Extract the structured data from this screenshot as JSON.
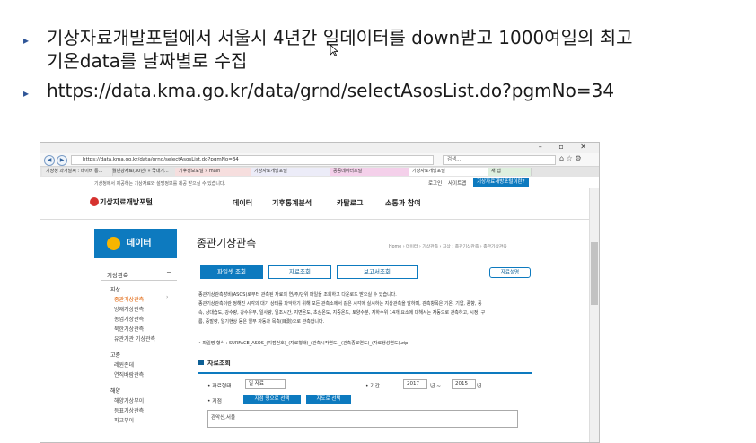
{
  "slide": {
    "bullets": [
      {
        "marker": "▸",
        "line1": "기상자료개발포털에서 서울시 4년간 일데이터를 down받고 1000여일의 최고",
        "line2": "기온data를 날짜별로 수집"
      },
      {
        "marker": "▸",
        "line1": "https://data.kma.go.kr/data/grnd/selectAsosList.do?pgmNo=34"
      }
    ]
  },
  "browser": {
    "url": "https://data.kma.go.kr/data/grnd/selectAsosList.do?pgmNo=34",
    "search_placeholder": "검색...",
    "tabs": [
      "기상청 과거날씨 : 네이버 통...",
      "월년강자료(30년) » 국내기...",
      "기후정보포털 » main",
      "기상자료개방포털",
      "공공데이터포털",
      "기상자료개방포털",
      "새 탭"
    ],
    "info_text": "기상청에서 제공하는 기상자료와 설명정보를 제공 받으실 수 있습니다.",
    "info_links": [
      "로그인",
      "사이트맵"
    ],
    "info_button": "기상자료개방포털이란?"
  },
  "site": {
    "logo": "기상자료개방포털",
    "gnb": [
      "데이터",
      "기후통계분석",
      "카탈로그",
      "소통과 참여"
    ],
    "lnb": {
      "title": "데이터",
      "section1": "기상관측",
      "section1_toggle": "−",
      "group1": "지상",
      "group1_items": [
        "종관기상관측",
        "방재기상관측",
        "농업기상관측",
        "북한기상관측",
        "유관기관 기상관측"
      ],
      "group2": "고층",
      "group2_items": [
        "레윈존데",
        "연직바람관측"
      ],
      "group3": "해양",
      "group3_items": [
        "해양기상부이",
        "등표기상관측",
        "파고부이"
      ]
    },
    "content": {
      "title": "종관기상관측",
      "breadcrumb": "Home › 데이터 › 기상관측 › 지상 › 종관기상관측 › 종관기상관측",
      "tabs": [
        "파일셋 조회",
        "자료조회",
        "보고서조회"
      ],
      "help": "자료설명",
      "desc_lines": [
        "종관기상관측장비(ASOS)로부터 관측된 자료의 연/주/단위 파일을 조회하고 다운로드 받으실 수 있습니다.",
        "종관기상관측이란 정해진 시각의 대기 상태를 파악하기 위해 모든 관측소에서 같은 시각에 실시하는 지상관측을 말하며, 관측항목은 기온, 기압, 풍향, 풍",
        "속, 상대습도, 강수량, 강수유무, 일사량, 일조시간, 지면온도, 초상온도, 지중온도, 토양수분, 지하수위 14개 요소에 대해서는 자동으로 관측하고, 시정, 구",
        "름, 증발량, 일기현상 등은 일부 자동과 목측(目測)으로 관측합니다."
      ],
      "file_format": "• 파일명 형식 : SURFACE_ASOS_(지점번호)_(자료형태)_(관측시작연도)_(관측종료연도)_(자료생성연도).zip",
      "section_title": "자료조회",
      "form": {
        "type_label": "• 자료형태",
        "type_value": "일 자료",
        "period_label": "• 기간",
        "from_year": "2017",
        "from_suffix": "년 ~",
        "to_year": "2015",
        "to_suffix": "년",
        "station_label": "• 지점",
        "btn_name": "지점 명으로 선택",
        "btn_map": "지도로 선택",
        "stations": "관악산,서울"
      }
    }
  }
}
